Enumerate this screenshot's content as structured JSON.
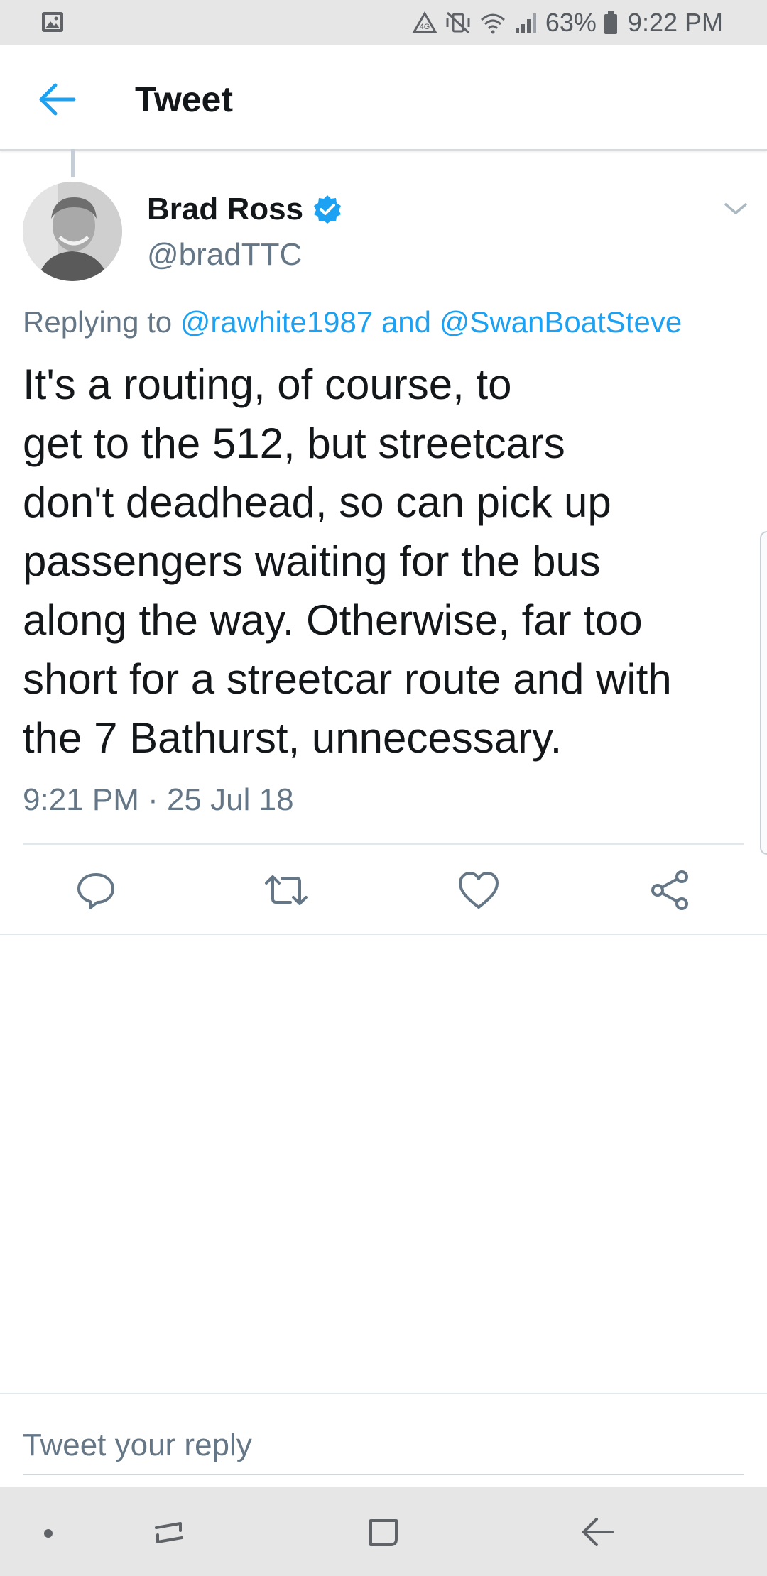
{
  "status_bar": {
    "battery": "63%",
    "time": "9:22 PM",
    "icons": [
      "image-notification-icon",
      "data-saver-icon",
      "vibrate-mute-icon",
      "wifi-icon",
      "signal-icon",
      "battery-icon"
    ]
  },
  "app_bar": {
    "back_icon": "arrow-left-icon",
    "title": "Tweet"
  },
  "tweet": {
    "author_name": "Brad Ross",
    "verified": true,
    "handle": "@bradTTC",
    "reply_prefix": "Replying to",
    "reply_mention_1": "@rawhite1987",
    "reply_joiner": "and",
    "reply_mention_2": "@SwanBoatSteve",
    "text_lines": [
      "It's a routing, of course, to",
      "get to the 512, but streetcars",
      "don't deadhead, so can pick up",
      "passengers waiting for the bus",
      "along the way. Otherwise, far too",
      "short for a streetcar route and with",
      "the 7 Bathurst, unnecessary."
    ],
    "timestamp": "9:21 PM · 25 Jul 18"
  },
  "actions": [
    "reply-icon",
    "retweet-icon",
    "like-icon",
    "share-icon"
  ],
  "reply_box": {
    "placeholder": "Tweet your reply",
    "value": ""
  },
  "colors": {
    "accent": "#1da1f2",
    "text_primary": "#14171a",
    "text_secondary": "#657786",
    "divider": "#e1e8ed",
    "system_bar": "#e6e6e6"
  }
}
